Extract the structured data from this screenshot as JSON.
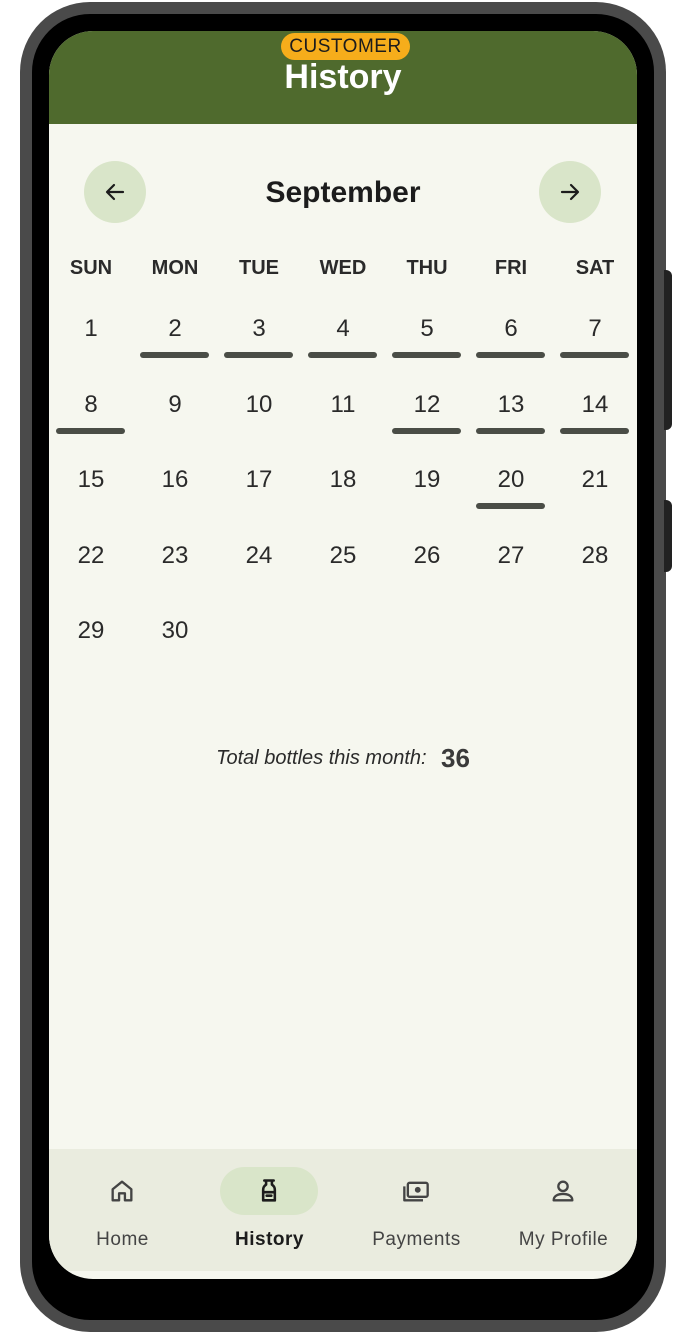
{
  "header": {
    "role_badge": "CUSTOMER",
    "title": "History"
  },
  "calendar": {
    "month": "September",
    "weekdays": [
      "SUN",
      "MON",
      "TUE",
      "WED",
      "THU",
      "FRI",
      "SAT"
    ],
    "start_weekday": 0,
    "days_in_month": 30,
    "delivery_days": [
      2,
      3,
      4,
      5,
      6,
      7,
      8,
      12,
      13,
      14,
      20
    ]
  },
  "summary": {
    "label": "Total bottles this month:",
    "value": "36"
  },
  "bottom_nav": {
    "items": [
      {
        "label": "Home",
        "icon": "home-icon",
        "active": false
      },
      {
        "label": "History",
        "icon": "bottle-icon",
        "active": true
      },
      {
        "label": "Payments",
        "icon": "payments-icon",
        "active": false
      },
      {
        "label": "My Profile",
        "icon": "profile-icon",
        "active": false
      }
    ]
  },
  "colors": {
    "header": "#4f6a2d",
    "badge": "#f6ad1b",
    "accent_light": "#d9e5c9",
    "background": "#f6f7ef",
    "delivery_bar": "#4a4d46"
  }
}
